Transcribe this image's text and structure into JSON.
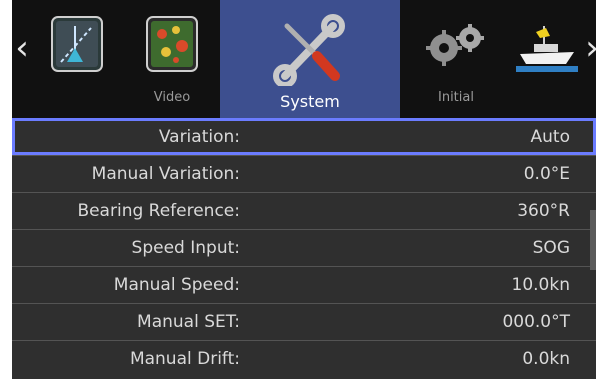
{
  "tabs": [
    {
      "label": "",
      "icon": "plotter-icon"
    },
    {
      "label": "Video",
      "icon": "video-icon"
    },
    {
      "label": "System",
      "icon": "wrench-screwdriver-icon",
      "active": true
    },
    {
      "label": "Initial",
      "icon": "gears-icon"
    },
    {
      "label": "",
      "icon": "boat-icon"
    }
  ],
  "nav": {
    "left": "‹",
    "right": "›"
  },
  "rows": [
    {
      "name": "Variation:",
      "value": "Auto"
    },
    {
      "name": "Manual Variation:",
      "value": "0.0°E"
    },
    {
      "name": "Bearing Reference:",
      "value": "360°R"
    },
    {
      "name": "Speed Input:",
      "value": "SOG"
    },
    {
      "name": "Manual Speed:",
      "value": "10.0kn"
    },
    {
      "name": "Manual SET:",
      "value": "000.0°T"
    },
    {
      "name": "Manual Drift:",
      "value": "0.0kn"
    }
  ],
  "colors": {
    "accent": "#3d4f8f",
    "selection": "#6b7cff",
    "background": "#2f2f2f"
  }
}
